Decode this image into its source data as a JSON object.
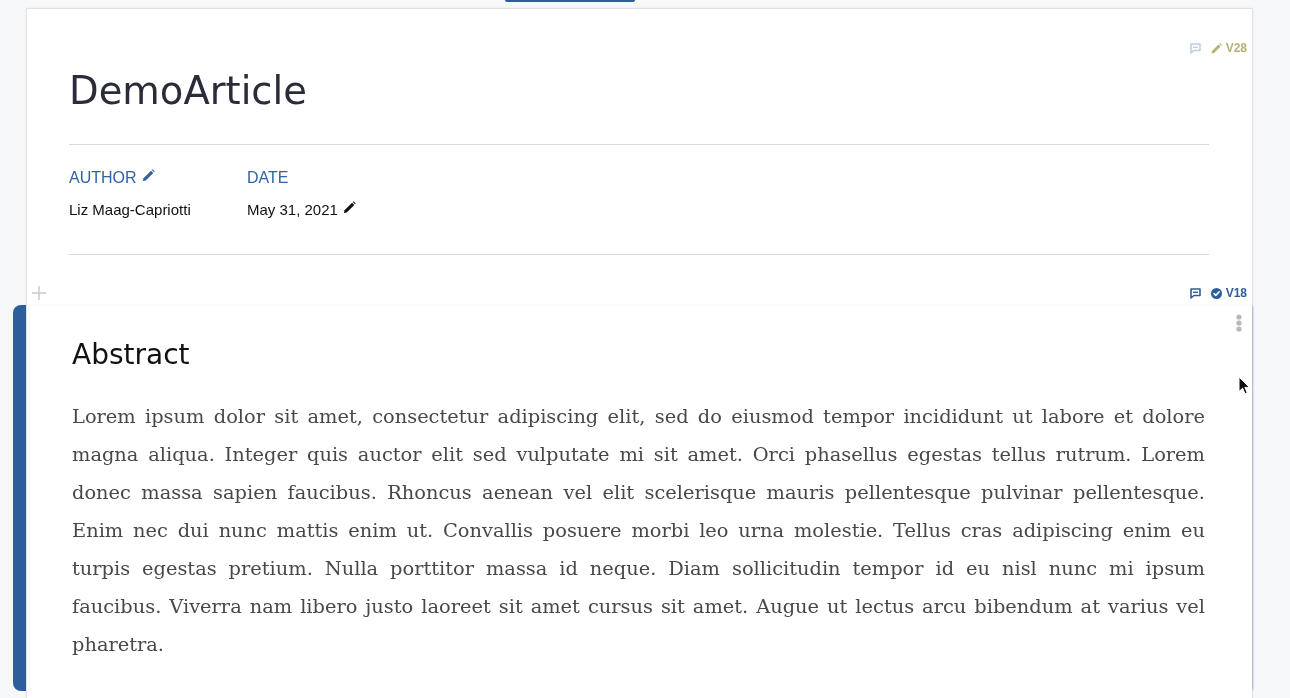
{
  "blocks": [
    {
      "kind": "header",
      "selected": false,
      "version": {
        "label": "V28",
        "approved": false
      },
      "title": "DemoArticle",
      "fields": [
        {
          "label": "AUTHOR",
          "value": "Liz Maag-Capriotti",
          "label_edit_icon": true,
          "value_edit_icon": false
        },
        {
          "label": "DATE",
          "value": "May 31, 2021",
          "label_edit_icon": false,
          "value_edit_icon": true
        }
      ]
    },
    {
      "kind": "section",
      "selected": true,
      "version": {
        "label": "V18",
        "approved": true
      },
      "heading": "Abstract",
      "body": "Lorem ipsum dolor sit amet, consectetur adipiscing elit, sed do eiusmod tempor incididunt ut labore et dolore magna aliqua. Integer quis auctor elit sed vulputate mi sit amet. Orci phasellus egestas tellus rutrum. Lorem donec massa sapien faucibus. Rhoncus aenean vel elit scelerisque mauris pellentesque pulvinar pellentesque. Enim nec dui nunc mattis enim ut. Convallis posuere morbi leo urna molestie. Tellus cras adipiscing enim eu turpis egestas pretium. Nulla porttitor massa id neque. Diam sollicitudin tempor id eu nisl nunc mi ipsum faucibus. Viverra nam libero justo laoreet sit amet cursus sit amet. Augue ut lectus arcu bibendum at varius vel pharetra."
    }
  ]
}
